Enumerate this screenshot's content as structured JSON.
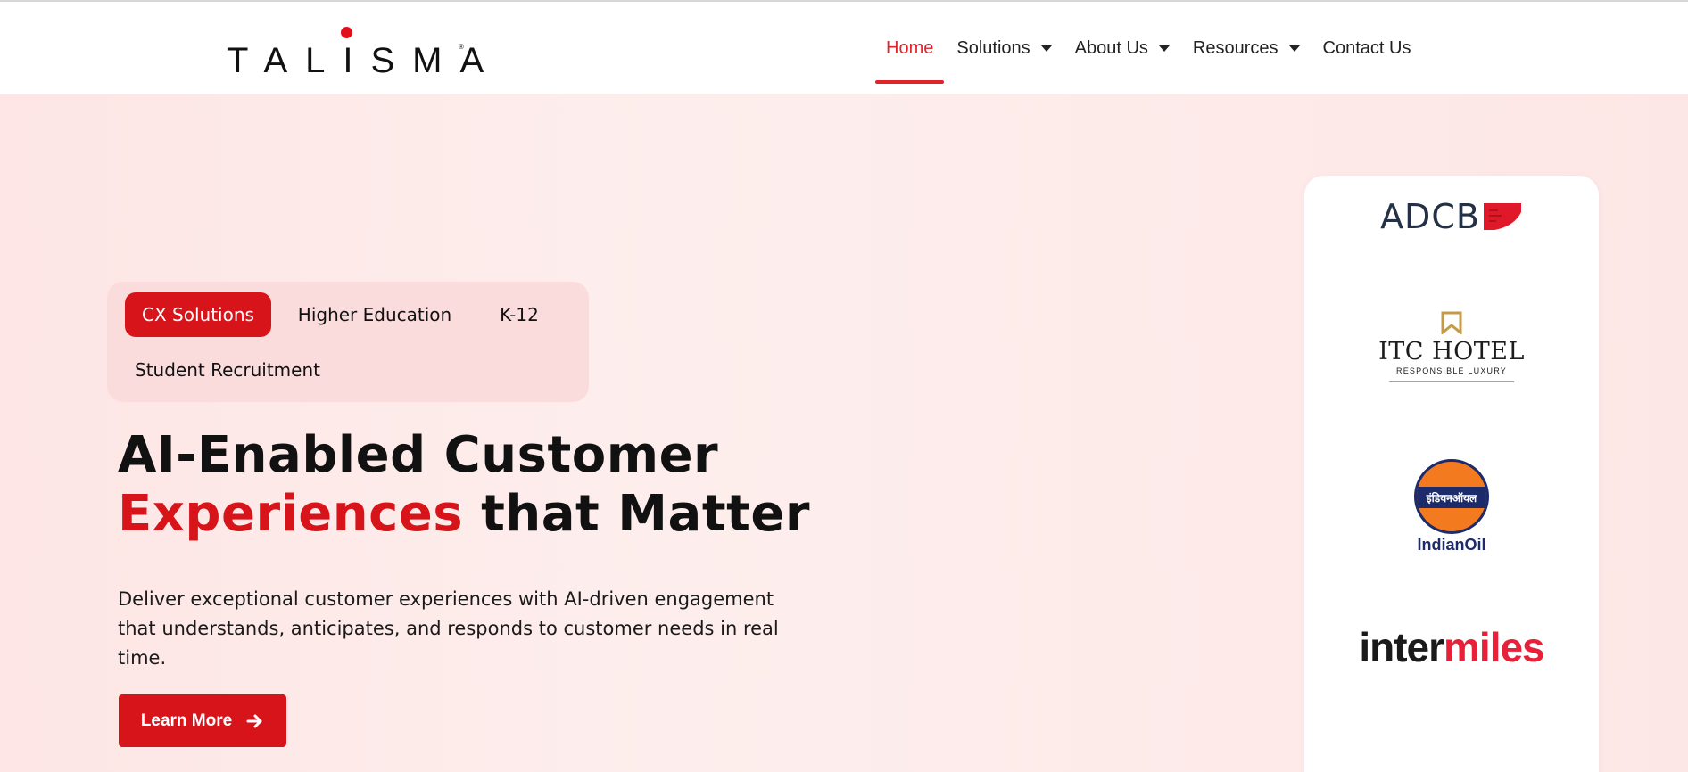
{
  "brand": {
    "logo_text": "TALISMA",
    "accent_color": "#d8141b"
  },
  "nav": {
    "items": [
      {
        "label": "Home",
        "active": true,
        "has_dropdown": false
      },
      {
        "label": "Solutions",
        "active": false,
        "has_dropdown": true
      },
      {
        "label": "About Us",
        "active": false,
        "has_dropdown": true
      },
      {
        "label": "Resources",
        "active": false,
        "has_dropdown": true
      },
      {
        "label": "Contact Us",
        "active": false,
        "has_dropdown": false
      }
    ]
  },
  "hero": {
    "tabs": [
      {
        "label": "CX Solutions",
        "active": true
      },
      {
        "label": "Higher Education",
        "active": false
      },
      {
        "label": "K-12",
        "active": false
      },
      {
        "label": "Student Recruitment",
        "active": false
      }
    ],
    "title_line1": "AI-Enabled Customer",
    "title_highlight": "Experiences",
    "title_rest": " that Matter",
    "description": "Deliver exceptional customer experiences with AI-driven engagement that understands, anticipates, and responds to customer needs in real time.",
    "cta_label": "Learn More",
    "cta_icon": "arrow-right-icon"
  },
  "clients": {
    "adcb": {
      "text": "ADCB"
    },
    "itc": {
      "name": "ITC HOTEL",
      "tagline": "RESPONSIBLE LUXURY"
    },
    "indianoil": {
      "hindi": "इंडियनऑयल",
      "name": "IndianOil"
    },
    "intermiles": {
      "inter": "inter",
      "miles": "miles"
    }
  }
}
